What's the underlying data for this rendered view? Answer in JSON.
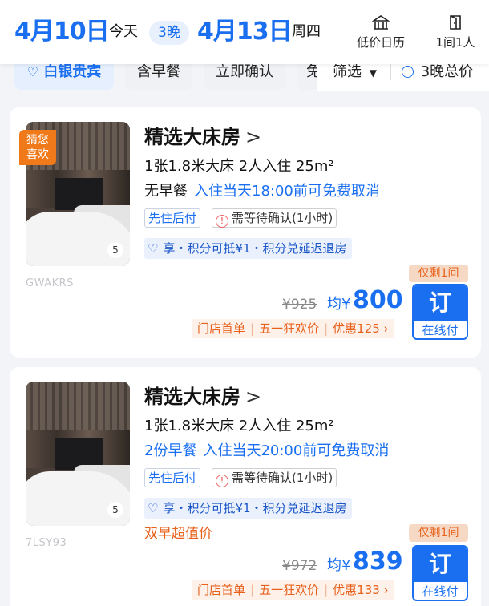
{
  "header": {
    "checkin_date": "4月10日",
    "checkin_sub": "今天",
    "nights": "3晚",
    "checkout_date": "4月13日",
    "checkout_sub": "周四",
    "calendar_label": "低价日历",
    "rooms_guests_label": "1间1人"
  },
  "filters": {
    "chips": [
      "白银贵宾",
      "含早餐",
      "立即确认",
      "免"
    ],
    "filter_label": "筛选",
    "total_label": "3晚总价"
  },
  "rooms": [
    {
      "badge": "猜您喜欢",
      "photo_count": "5",
      "code": "GWAKRS",
      "title": "精选大床房",
      "spec": "1张1.8米大床  2人入住  25m²",
      "meal": "无早餐",
      "cancel": "入住当天18:00前可免费取消",
      "tag1": "先住后付",
      "tag2": "需等待确认(1小时)",
      "benefit": "享・积分可抵¥1・积分兑延迟退房",
      "deal_text": "",
      "remaining": "仅剩1间",
      "old_price": "¥925",
      "avg_label": "均¥",
      "price": "800",
      "book_label": "订",
      "book_sub": "在线付",
      "promos": [
        "门店首单",
        "五一狂欢价",
        "优惠125 ›"
      ]
    },
    {
      "badge": "",
      "photo_count": "5",
      "code": "7LSY93",
      "title": "精选大床房",
      "spec": "1张1.8米大床  2人入住  25m²",
      "meal": "2份早餐",
      "cancel": "入住当天20:00前可免费取消",
      "tag1": "先住后付",
      "tag2": "需等待确认(1小时)",
      "benefit": "享・积分可抵¥1・积分兑延迟退房",
      "deal_text": "双早超值价",
      "remaining": "仅剩1间",
      "old_price": "¥972",
      "avg_label": "均¥",
      "price": "839",
      "book_label": "订",
      "book_sub": "在线付",
      "promos": [
        "门店首单",
        "五一狂欢价",
        "优惠133 ›"
      ]
    }
  ]
}
